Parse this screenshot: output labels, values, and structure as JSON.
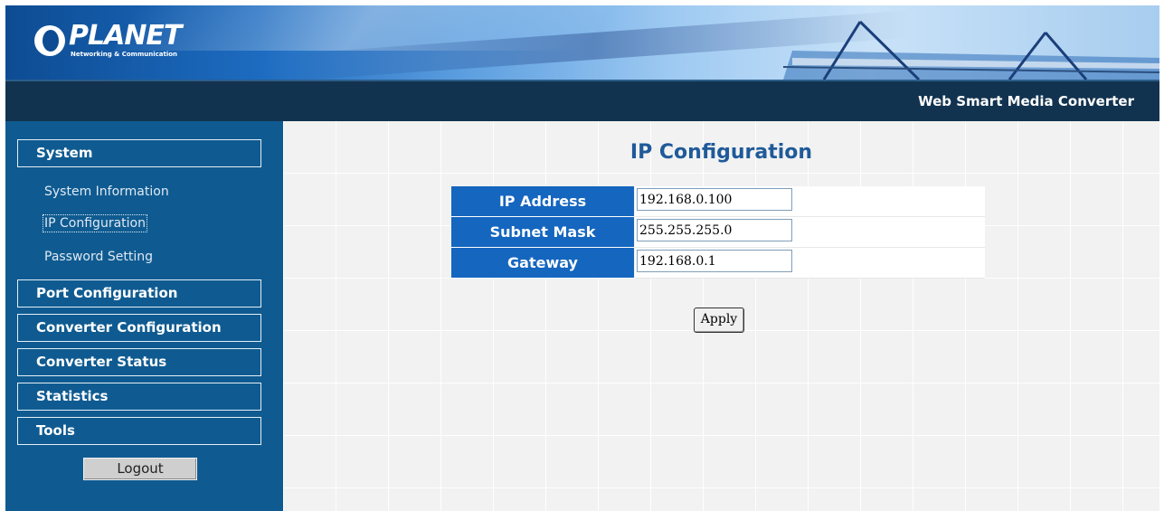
{
  "brand": {
    "logo_text": "PLANET",
    "logo_tagline": "Networking & Communication",
    "product_name": "Web Smart Media Converter"
  },
  "sidebar": {
    "system_label": "System",
    "system_items": [
      {
        "label": "System Information"
      },
      {
        "label": "IP Configuration",
        "active": true
      },
      {
        "label": "Password Setting"
      }
    ],
    "sections": [
      {
        "label": "Port Configuration"
      },
      {
        "label": "Converter Configuration"
      },
      {
        "label": "Converter Status"
      },
      {
        "label": "Statistics"
      },
      {
        "label": "Tools"
      }
    ],
    "logout_label": "Logout"
  },
  "main": {
    "title": "IP Configuration",
    "fields": [
      {
        "label": "IP Address",
        "value": "192.168.0.100"
      },
      {
        "label": "Subnet Mask",
        "value": "255.255.255.0"
      },
      {
        "label": "Gateway",
        "value": "192.168.0.1"
      }
    ],
    "apply_label": "Apply"
  },
  "colors": {
    "banner_dark": "#12334f",
    "sidebar_bg": "#0f5b91",
    "label_cell": "#1566bf",
    "title_text": "#1f5a99"
  }
}
